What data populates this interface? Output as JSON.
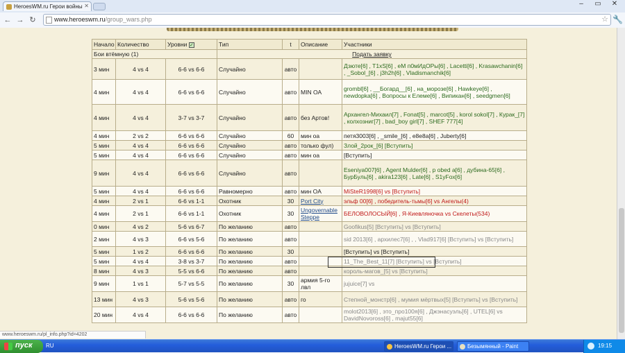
{
  "browser": {
    "tab_title": "HeroesWM.ru Герои войны",
    "url_host": "www.heroeswm.ru",
    "url_path": "/group_wars.php"
  },
  "table": {
    "headers": [
      "Начало",
      "Количество",
      "Уровни",
      "Тип",
      "t",
      "Описание",
      "Участники"
    ],
    "section_label": "Бои втёмную (1)",
    "apply_label": "Подать заявку",
    "rows": [
      {
        "start": "3 мин",
        "count": "4 vs 4",
        "levels": "6-6 vs 6-6",
        "type": "Случайно",
        "t": "авто",
        "desc": "",
        "participants": "Дзюте[6] , T1xS[6] , eM п0мИдОРы[6] , Lacetti[6] , Krasawchanin[6] , _Sobol_[6] , j3h2h[6] , Vladismanchik[6]",
        "pc": "p"
      },
      {
        "start": "4 мин",
        "count": "4 vs 4",
        "levels": "6-6 vs 6-6",
        "type": "Случайно",
        "t": "авто",
        "desc": "MIN OA",
        "participants": "grombl[6] , __Богард__[6] , на_морозе[6] , Hawkeye[6] , newdopka[6] , Вопросы к Елеме[6] , Випикан[6] , seedgmen[6]",
        "pc": "p"
      },
      {
        "start": "4 мин",
        "count": "4 vs 4",
        "levels": "3-7 vs 3-7",
        "type": "Случайно",
        "t": "авто",
        "desc": "без Артов!",
        "participants": "Архангел-Михаил[7] , Fonat[5] , marcot[5] , korol sokol[7] , Курак_[7] , колхозниг[7] , bad_boy girl[7] , SHEF 777[4]",
        "pc": "p"
      },
      {
        "start": "4 мин",
        "count": "2 vs 2",
        "levels": "6-6 vs 6-6",
        "type": "Случайно",
        "t": "60",
        "desc": "мин оа",
        "participants": "петя3003[6] , _smile_[6] , e8e8a[6] , Juberty[6]",
        "pc": ""
      },
      {
        "start": "5 мин",
        "count": "4 vs 4",
        "levels": "6-6 vs 6-6",
        "type": "Случайно",
        "t": "авто",
        "desc": "только фул)",
        "participants": "Злой_2рок_[6] [Вступить]",
        "pc": "p"
      },
      {
        "start": "5 мин",
        "count": "4 vs 4",
        "levels": "6-6 vs 6-6",
        "type": "Случайно",
        "t": "авто",
        "desc": "мин оа",
        "participants": "[Вступить]",
        "pc": ""
      },
      {
        "start": "9 мин",
        "count": "4 vs 4",
        "levels": "6-6 vs 6-6",
        "type": "Случайно",
        "t": "авто",
        "desc": "",
        "participants": "Eseniya007[6] , Agent Mulder[6] , p obed a[6] , дубина-65[6] , БурБуль[6] , akira123[6] , Late[6] , S1yFox[6]",
        "pc": "p"
      },
      {
        "start": "5 мин",
        "count": "4 vs 4",
        "levels": "6-6 vs 6-6",
        "type": "Равномерно",
        "t": "авто",
        "desc": "мин OA",
        "participants": "MiSteR1998[6] vs [Вступить]",
        "pc": "r"
      },
      {
        "start": "4 мин",
        "count": "2 vs 1",
        "levels": "6-6 vs 1-1",
        "type": "Охотник",
        "t": "30",
        "desc": "Port City",
        "participants": "эльф 00[6] , победитель-тьмы[6] vs Ангелы(4)",
        "pc": "r"
      },
      {
        "start": "4 мин",
        "count": "2 vs 1",
        "levels": "6-6 vs 1-1",
        "type": "Охотник",
        "t": "30",
        "desc": "Ungovernable Steppe",
        "participants": "БЕЛОВОЛОСЫЙ[6] , Я-Киевляночка vs Скелеты(534)",
        "pc": "r"
      },
      {
        "start": "0 мин",
        "count": "4 vs 2",
        "levels": "5-6 vs 6-7",
        "type": "По желанию",
        "t": "авто",
        "desc": "",
        "participants": "Goofikus[5] [Вступить] vs [Вступить]",
        "pc": "g"
      },
      {
        "start": "2 мин",
        "count": "4 vs 3",
        "levels": "6-6 vs 5-6",
        "type": "По желанию",
        "t": "авто",
        "desc": "",
        "participants": "sid 2013[6] , архилес7[6] , , Vlad917[6] [Вступить] vs [Вступить]",
        "pc": "g"
      },
      {
        "start": "5 мин",
        "count": "1 vs 2",
        "levels": "6-6 vs 6-6",
        "type": "По желанию",
        "t": "30",
        "desc": "",
        "participants": "[Вступить] vs [Вступить]",
        "pc": ""
      },
      {
        "start": "5 мин",
        "count": "4 vs 4",
        "levels": "3-8 vs 3-7",
        "type": "По желанию",
        "t": "авто",
        "desc": "",
        "participants": "11_The_Best_11[7] [Вступить] vs [Вступить]",
        "pc": "g"
      },
      {
        "start": "8 мин",
        "count": "4 vs 3",
        "levels": "5-5 vs 6-6",
        "type": "По желанию",
        "t": "авто",
        "desc": "",
        "participants": "король-магов_[5] vs [Вступить]",
        "pc": "g"
      },
      {
        "start": "9 мин",
        "count": "1 vs 1",
        "levels": "5-7 vs 5-5",
        "type": "По желанию",
        "t": "30",
        "desc": "армия 5-го лвл",
        "participants": "jujuice[7] vs",
        "pc": "g"
      },
      {
        "start": "13 мин",
        "count": "4 vs 3",
        "levels": "5-6 vs 5-6",
        "type": "По желанию",
        "t": "авто",
        "desc": "го",
        "participants": "Степной_монстр[6] , мумия мёртвых[5] [Вступить] vs [Вступить]",
        "pc": "g"
      },
      {
        "start": "20 мин",
        "count": "4 vs 4",
        "levels": "6-6 vs 6-6",
        "type": "По желанию",
        "t": "авто",
        "desc": "",
        "participants": "molot2013[6] , это_про100я[6] , Джэнасуэль[6] , UTEL[6] vs DavidNovoross[6] , majut55[6]",
        "pc": "g"
      }
    ]
  },
  "status_url": "www.heroeswm.ru/pl_info.php?id=4202",
  "taskbar": {
    "start": "пуск",
    "lang": "RU",
    "btn1": "HeroesWM.ru Герои ...",
    "btn2": "Безымянный - Paint",
    "clock": "19:15"
  }
}
